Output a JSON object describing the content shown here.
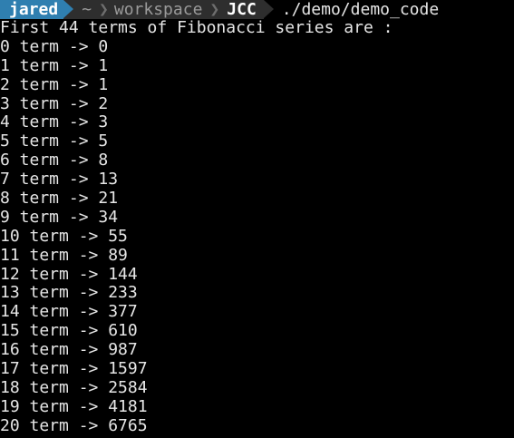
{
  "prompt": {
    "user": "jared",
    "path": [
      "~",
      "workspace"
    ],
    "current_dir": "JCC",
    "command": "./demo/demo_code"
  },
  "output": {
    "header": "First 44 terms of Fibonacci series are :",
    "lines": [
      "0 term -> 0",
      "1 term -> 1",
      "2 term -> 1",
      "3 term -> 2",
      "4 term -> 3",
      "5 term -> 5",
      "6 term -> 8",
      "7 term -> 13",
      "8 term -> 21",
      "9 term -> 34",
      "10 term -> 55",
      "11 term -> 89",
      "12 term -> 144",
      "13 term -> 233",
      "14 term -> 377",
      "15 term -> 610",
      "16 term -> 987",
      "17 term -> 1597",
      "18 term -> 2584",
      "19 term -> 4181",
      "20 term -> 6765"
    ]
  },
  "colors": {
    "background": "#000000",
    "text": "#e6e6e6",
    "user_segment": "#2f7fb0",
    "path_segment": "#2e2e2e"
  }
}
